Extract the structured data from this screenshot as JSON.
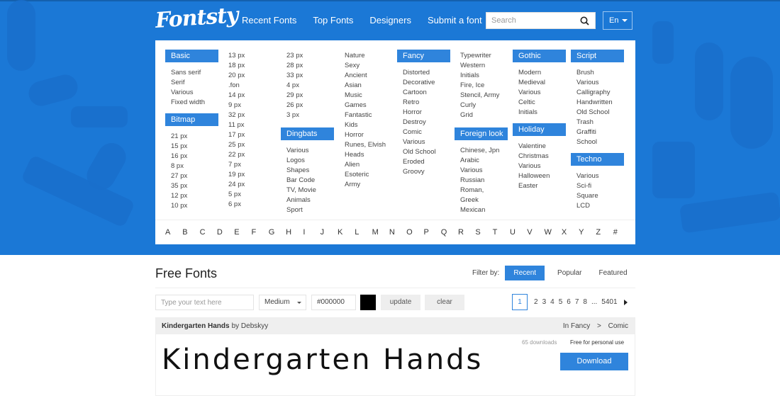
{
  "header": {
    "logo": "Fontsty",
    "nav": [
      "Recent Fonts",
      "Top Fonts",
      "Designers",
      "Submit a font"
    ],
    "search_placeholder": "Search",
    "language": "En"
  },
  "menu": {
    "basic": {
      "title": "Basic",
      "items": [
        "Sans serif",
        "Serif",
        "Various",
        "Fixed width"
      ]
    },
    "bitmap": {
      "title": "Bitmap",
      "items": [
        "21 px",
        "15 px",
        "16 px",
        "8 px",
        "27 px",
        "35 px",
        "12 px",
        "10 px"
      ]
    },
    "bitmap_col2": [
      "13 px",
      "18 px",
      "20 px",
      ".fon",
      "14 px",
      "9 px",
      "32 px",
      "11 px",
      "17 px",
      "25 px",
      "22 px",
      "7 px",
      "19 px",
      "24 px",
      "5 px",
      "6 px"
    ],
    "bitmap_col3": [
      "23 px",
      "28 px",
      "33 px",
      "4 px",
      "29 px",
      "26 px",
      "3 px"
    ],
    "dingbats": {
      "title": "Dingbats",
      "items": [
        "Various",
        "Logos",
        "Shapes",
        "Bar Code",
        "TV, Movie",
        "Animals",
        "Sport"
      ]
    },
    "dingbats_col2": [
      "Nature",
      "Sexy",
      "Ancient",
      "Asian",
      "Music",
      "Games",
      "Fantastic",
      "Kids",
      "Horror",
      "Runes, Elvish",
      "Heads",
      "Alien",
      "Esoteric",
      "Army"
    ],
    "fancy": {
      "title": "Fancy",
      "items": [
        "Distorted",
        "Decorative",
        "Cartoon",
        "Retro",
        "Horror",
        "Destroy",
        "Comic",
        "Various",
        "Old School",
        "Eroded",
        "Groovy"
      ]
    },
    "fancy_col2": [
      "Typewriter",
      "Western",
      "Initials",
      "Fire, Ice",
      "Stencil, Army",
      "Curly",
      "Grid"
    ],
    "foreign": {
      "title": "Foreign look",
      "items": [
        "Chinese, Jpn",
        "Arabic",
        "Various",
        "Russian",
        "Roman,",
        "Greek",
        "Mexican"
      ]
    },
    "gothic": {
      "title": "Gothic",
      "items": [
        "Modern",
        "Medieval",
        "Various",
        "Celtic",
        "Initials"
      ]
    },
    "holiday": {
      "title": "Holiday",
      "items": [
        "Valentine",
        "Christmas",
        "Various",
        "Halloween",
        "Easter"
      ]
    },
    "script": {
      "title": "Script",
      "items": [
        "Brush",
        "Various",
        "Calligraphy",
        "Handwritten",
        "Old School",
        "Trash",
        "Graffiti",
        "School"
      ]
    },
    "techno": {
      "title": "Techno",
      "items": [
        "Various",
        "Sci-fi",
        "Square",
        "LCD"
      ]
    },
    "alphabet": [
      "A",
      "B",
      "C",
      "D",
      "E",
      "F",
      "G",
      "H",
      "I",
      "J",
      "K",
      "L",
      "M",
      "N",
      "O",
      "P",
      "Q",
      "R",
      "S",
      "T",
      "U",
      "V",
      "W",
      "X",
      "Y",
      "Z",
      "#"
    ]
  },
  "main": {
    "title": "Free Fonts",
    "filter_label": "Filter by:",
    "filters": [
      "Recent",
      "Popular",
      "Featured"
    ],
    "active_filter": "Recent",
    "text_placeholder": "Type your text here",
    "size": "Medium",
    "color_value": "#000000",
    "swatch_color": "#000000",
    "update_label": "update",
    "clear_label": "clear",
    "pagination": {
      "current": "1",
      "pages": [
        "2",
        "3",
        "4",
        "5",
        "6",
        "7",
        "8"
      ],
      "ellipsis": "...",
      "last": "5401"
    }
  },
  "font_card": {
    "name": "Kindergarten Hands",
    "by": "by Debskyy",
    "category_prefix": "In Fancy",
    "category_sep": ">",
    "subcategory": "Comic",
    "preview_text": "Kindergarten Hands",
    "downloads": "65 downloads",
    "license": "Free for personal use",
    "download_label": "Download"
  },
  "colors": {
    "brand_blue": "#1b78d6",
    "accent": "#2f84dc"
  }
}
